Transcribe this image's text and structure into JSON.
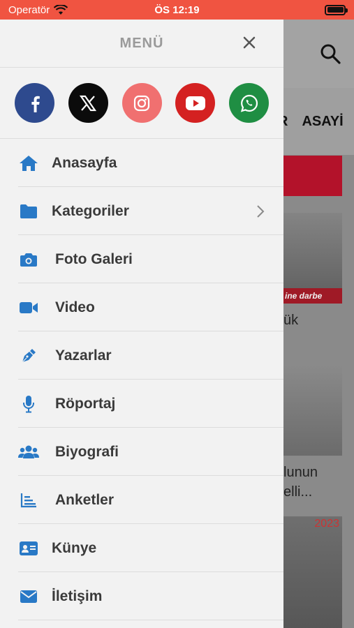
{
  "status_bar": {
    "carrier": "Operatör",
    "time": "ÖS 12:19"
  },
  "drawer": {
    "title": "MENÜ",
    "social": [
      {
        "name": "facebook",
        "color": "#2e4a8e"
      },
      {
        "name": "x",
        "color": "#0b0b0b"
      },
      {
        "name": "instagram",
        "color": "#f07070"
      },
      {
        "name": "youtube",
        "color": "#d42121"
      },
      {
        "name": "whatsapp",
        "color": "#1f8e43"
      }
    ],
    "items": [
      {
        "label": "Anasayfa",
        "icon": "home-icon"
      },
      {
        "label": "Kategoriler",
        "icon": "folder-icon",
        "has_submenu": true
      },
      {
        "label": "Foto Galeri",
        "icon": "camera-icon"
      },
      {
        "label": "Video",
        "icon": "video-icon"
      },
      {
        "label": "Yazarlar",
        "icon": "pen-icon"
      },
      {
        "label": "Röportaj",
        "icon": "microphone-icon"
      },
      {
        "label": "Biyografi",
        "icon": "users-icon"
      },
      {
        "label": "Anketler",
        "icon": "chart-icon"
      },
      {
        "label": "Künye",
        "icon": "id-card-icon"
      },
      {
        "label": "İletişim",
        "icon": "envelope-icon"
      }
    ]
  },
  "background": {
    "tabs": [
      "R",
      "ASAYİ"
    ],
    "image_caption": "ine darbe",
    "headline_fragment_1": "ük",
    "headline_fragment_2a": "lunun",
    "headline_fragment_2b": "elli...",
    "image_year": "2023"
  },
  "colors": {
    "accent": "#2979c6",
    "status_bar": "#f05441"
  }
}
